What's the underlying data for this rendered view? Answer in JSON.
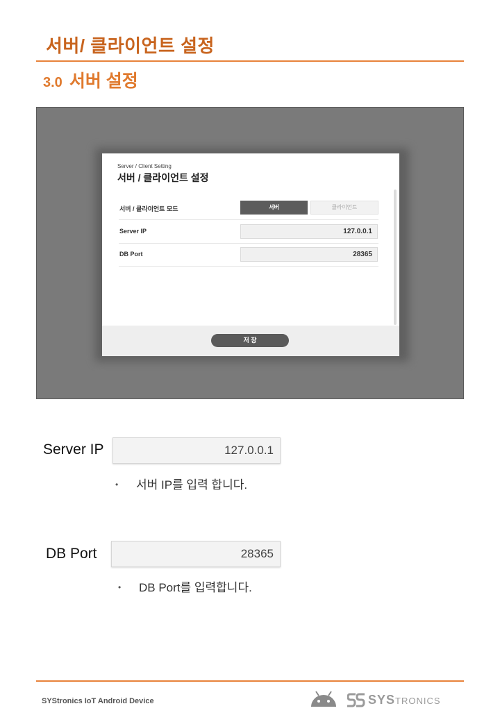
{
  "page": {
    "title": "서버/ 클라이언트 설정",
    "section_number": "3.0",
    "section_title": "서버 설정"
  },
  "dialog": {
    "small_title": "Server / Client Setting",
    "title": "서버 / 클라이언트 설정",
    "rows": [
      {
        "label": "서버 / 클라이언트 모드",
        "option_selected": "서버",
        "option_other": "클라이언트"
      },
      {
        "label": "Server IP",
        "value": "127.0.0.1"
      },
      {
        "label": "DB Port",
        "value": "28365"
      }
    ],
    "save_button": "저 장"
  },
  "details": [
    {
      "label": "Server IP",
      "value": "127.0.0.1",
      "description": "서버 IP를 입력 합니다."
    },
    {
      "label": "DB Port",
      "value": "28365",
      "description": "DB Port를 입력합니다."
    }
  ],
  "footer": {
    "text": "SYStronics IoT Android Device",
    "brand_big": "SYS",
    "brand_small": "TRONICS"
  },
  "colors": {
    "accent": "#e8823a",
    "title": "#c8641e"
  }
}
